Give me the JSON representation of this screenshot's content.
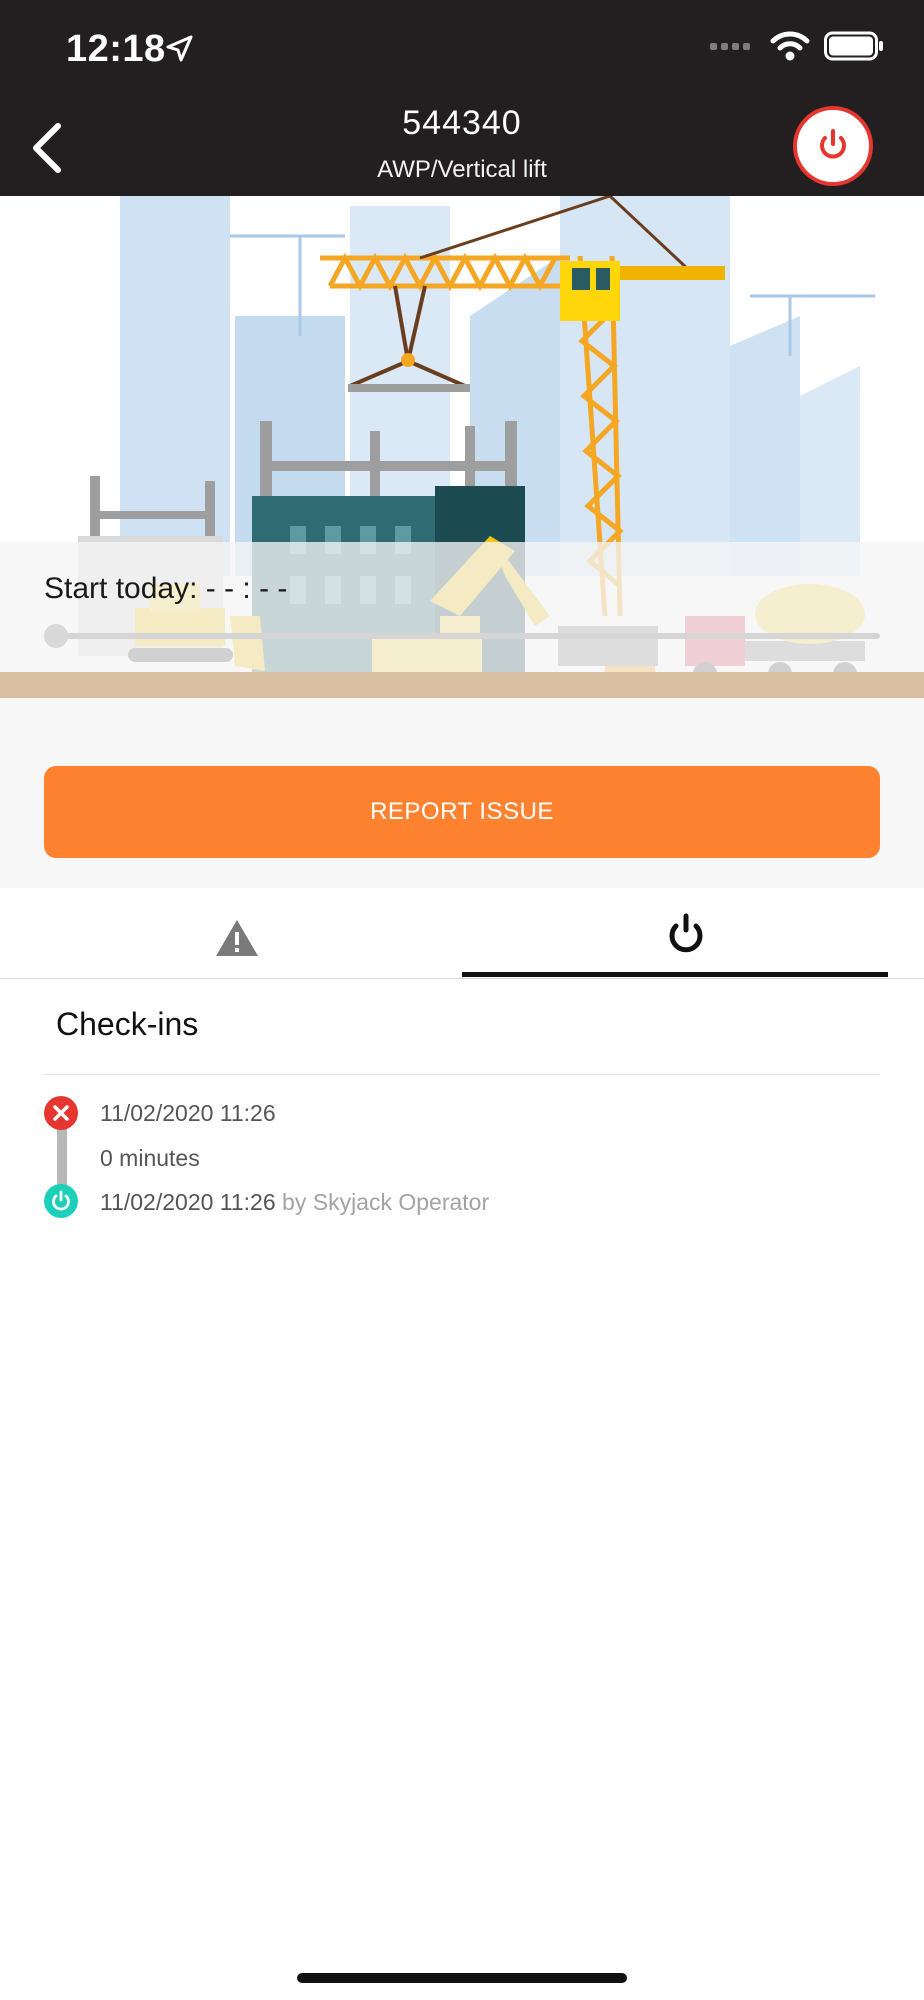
{
  "status_bar": {
    "time": "12:18"
  },
  "header": {
    "title": "544340",
    "subtitle": "AWP/Vertical lift"
  },
  "hero": {
    "start_label": "Start today: - - : - -"
  },
  "actions": {
    "report_issue": "REPORT ISSUE"
  },
  "tabs": [
    {
      "name": "issues",
      "icon": "warning-icon",
      "selected": false
    },
    {
      "name": "check-ins",
      "icon": "power-icon",
      "selected": true
    }
  ],
  "checkins": {
    "title": "Check-ins",
    "entries": [
      {
        "end_time": "11/02/2020 11:26",
        "duration": "0 minutes",
        "start_time": "11/02/2020 11:26",
        "by": "by Skyjack Operator"
      }
    ]
  },
  "colors": {
    "header_bg": "#231f20",
    "accent_orange": "#ff8231",
    "checkout_red": "#e5362f",
    "checkin_teal": "#1ccfb9"
  }
}
